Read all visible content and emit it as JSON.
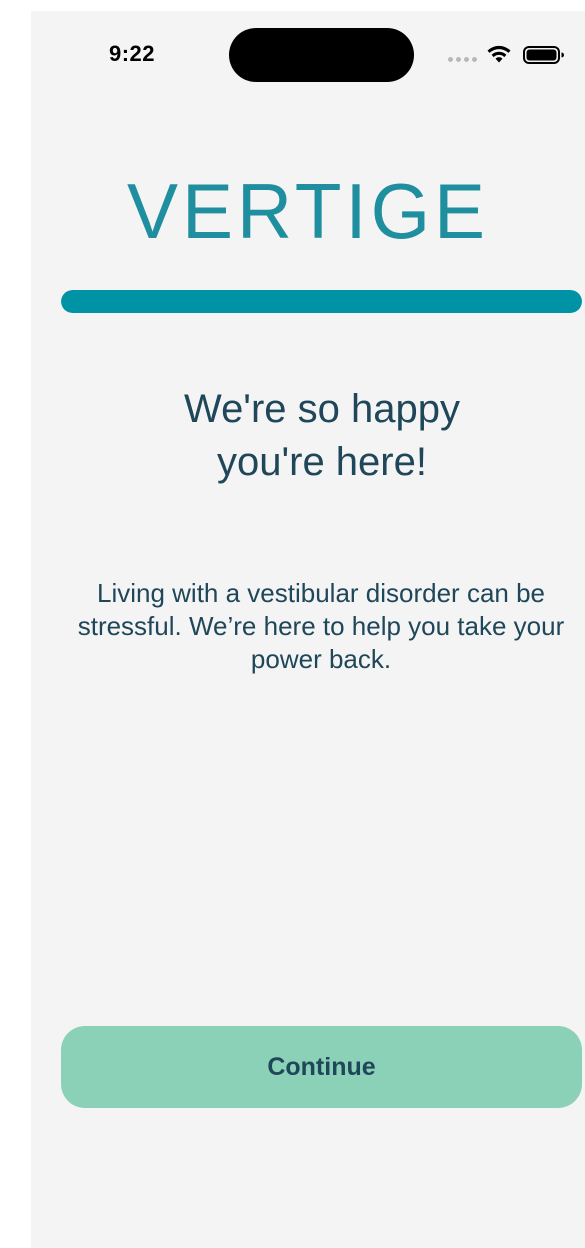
{
  "status_bar": {
    "time": "9:22"
  },
  "brand": {
    "logo_text": "VERTIGE",
    "color": "#1f8fa0"
  },
  "progress": {
    "fraction": 1.0,
    "fill_color": "#0093a5"
  },
  "onboarding": {
    "heading": "We're so happy\nyou're here!",
    "body": "Living with a vestibular disorder can be stressful. We’re here to help you take your power back."
  },
  "actions": {
    "continue_label": "Continue",
    "button_color": "#8ad1b8"
  }
}
